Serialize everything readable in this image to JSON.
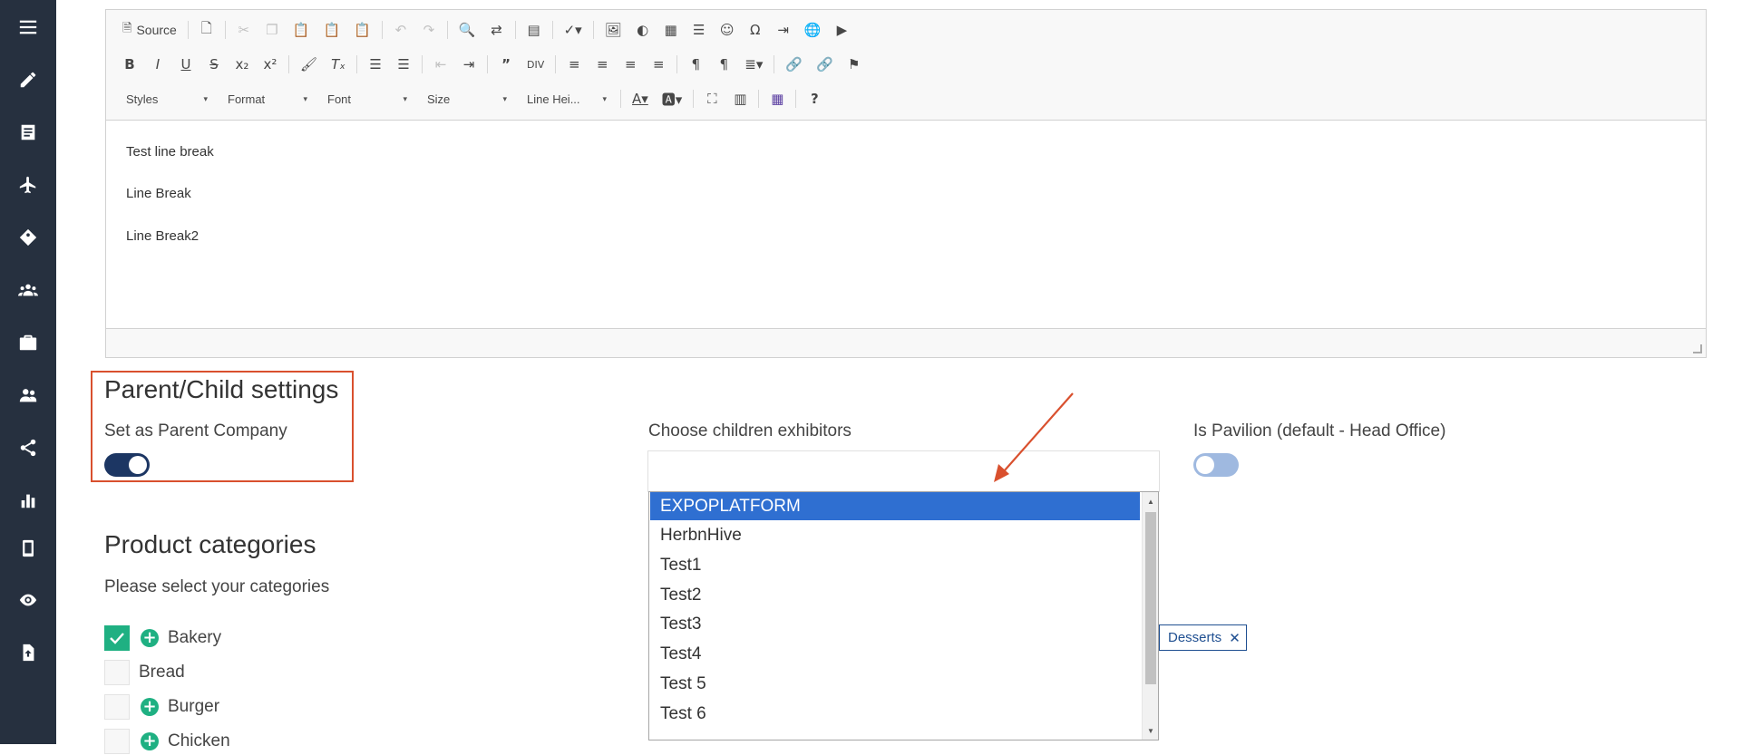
{
  "sidebar": {
    "items": [
      {
        "icon": "menu-icon"
      },
      {
        "icon": "pencil-icon"
      },
      {
        "icon": "document-icon"
      },
      {
        "icon": "airplane-icon"
      },
      {
        "icon": "tag-icon"
      },
      {
        "icon": "group-icon"
      },
      {
        "icon": "briefcase-icon"
      },
      {
        "icon": "users-icon"
      },
      {
        "icon": "share-icon"
      },
      {
        "icon": "bar-chart-icon"
      },
      {
        "icon": "mobile-icon"
      },
      {
        "icon": "eye-icon"
      },
      {
        "icon": "file-upload-icon"
      }
    ]
  },
  "editor": {
    "source_label": "Source",
    "styles_label": "Styles",
    "format_label": "Format",
    "font_label": "Font",
    "size_label": "Size",
    "line_height_label": "Line Hei...",
    "content_lines": [
      "Test line break",
      "Line Break",
      "Line Break2"
    ]
  },
  "parent_child": {
    "heading": "Parent/Child settings",
    "set_parent_label": "Set as Parent Company",
    "set_parent_on": true,
    "children_label": "Choose children exhibitors",
    "pavilion_label": "Is Pavilion (default - Head Office)",
    "pavilion_on": false
  },
  "dropdown": {
    "options": [
      "EXPOPLATFORM",
      "HerbnHive",
      "Test1",
      "Test2",
      "Test3",
      "Test4",
      "Test 5",
      "Test 6"
    ],
    "selected": "EXPOPLATFORM"
  },
  "tag": {
    "label": "Desserts"
  },
  "categories": {
    "heading": "Product categories",
    "subheading": "Please select your categories",
    "items": [
      {
        "label": "Bakery",
        "checked": true,
        "expandable": true
      },
      {
        "label": "Bread",
        "checked": false,
        "expandable": false
      },
      {
        "label": "Burger",
        "checked": false,
        "expandable": true
      },
      {
        "label": "Chicken",
        "checked": false,
        "expandable": true
      }
    ]
  },
  "colors": {
    "sidebar_bg": "#26303f",
    "highlight_border": "#d9502e",
    "toggle_on": "#1c3663",
    "toggle_off": "#9fb9e0",
    "dropdown_selected": "#2f6fd1",
    "checkbox_green": "#1fb082"
  }
}
